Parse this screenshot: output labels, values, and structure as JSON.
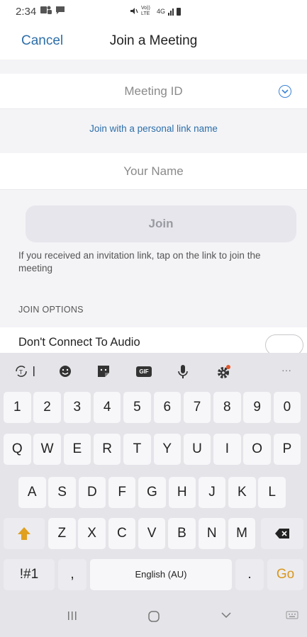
{
  "status": {
    "time": "2:34",
    "net": "Vo)) LTE",
    "gen": "4G"
  },
  "nav": {
    "cancel_label": "Cancel",
    "title": "Join a Meeting"
  },
  "form": {
    "meeting_id_placeholder": "Meeting ID",
    "personal_link_label": "Join with a personal link name",
    "name_placeholder": "Your Name",
    "join_label": "Join",
    "hint": "If you received an invitation link, tap on the link to join the meeting",
    "options_label": "JOIN OPTIONS",
    "audio_label": "Don't Connect To Audio",
    "audio_on": false
  },
  "keyboard": {
    "gif_label": "GIF",
    "rows": {
      "numbers": [
        "1",
        "2",
        "3",
        "4",
        "5",
        "6",
        "7",
        "8",
        "9",
        "0"
      ],
      "row1": [
        "Q",
        "W",
        "E",
        "R",
        "T",
        "Y",
        "U",
        "I",
        "O",
        "P"
      ],
      "row2": [
        "A",
        "S",
        "D",
        "F",
        "G",
        "H",
        "J",
        "K",
        "L"
      ],
      "row3": [
        "Z",
        "X",
        "C",
        "V",
        "B",
        "N",
        "M"
      ]
    },
    "symbols_label": "!#1",
    "comma_label": ",",
    "space_label": "English (AU)",
    "period_label": ".",
    "go_label": "Go",
    "go_color": "#d9971e",
    "shift_color": "#e0a020"
  },
  "colors": {
    "accent": "#2d6ea8",
    "background": "#f4f4f7"
  }
}
